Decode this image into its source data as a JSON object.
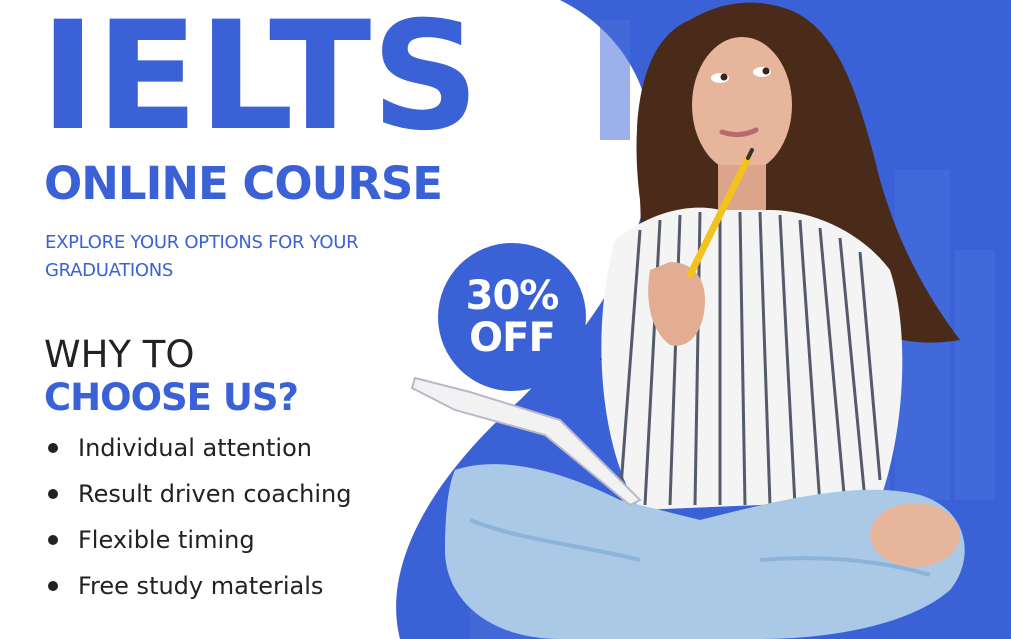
{
  "headline": "IELTS",
  "subheadline": "ONLINE COURSE",
  "tagline": "EXPLORE YOUR OPTIONS FOR YOUR GRADUATIONS",
  "why": {
    "line1": "WHY TO",
    "line2": "CHOOSE US?"
  },
  "features": [
    "Individual attention",
    "Result driven coaching",
    "Flexible timing",
    "Free study materials"
  ],
  "badge": {
    "percent": "30%",
    "off": "OFF"
  },
  "colors": {
    "brand_blue": "#3a62d6",
    "text_dark": "#222222",
    "background": "#ffffff"
  },
  "images": {
    "hero_photo": "woman-with-pencil-and-notebook-sitting-cross-legged",
    "background": "city-skyline-silhouette"
  }
}
